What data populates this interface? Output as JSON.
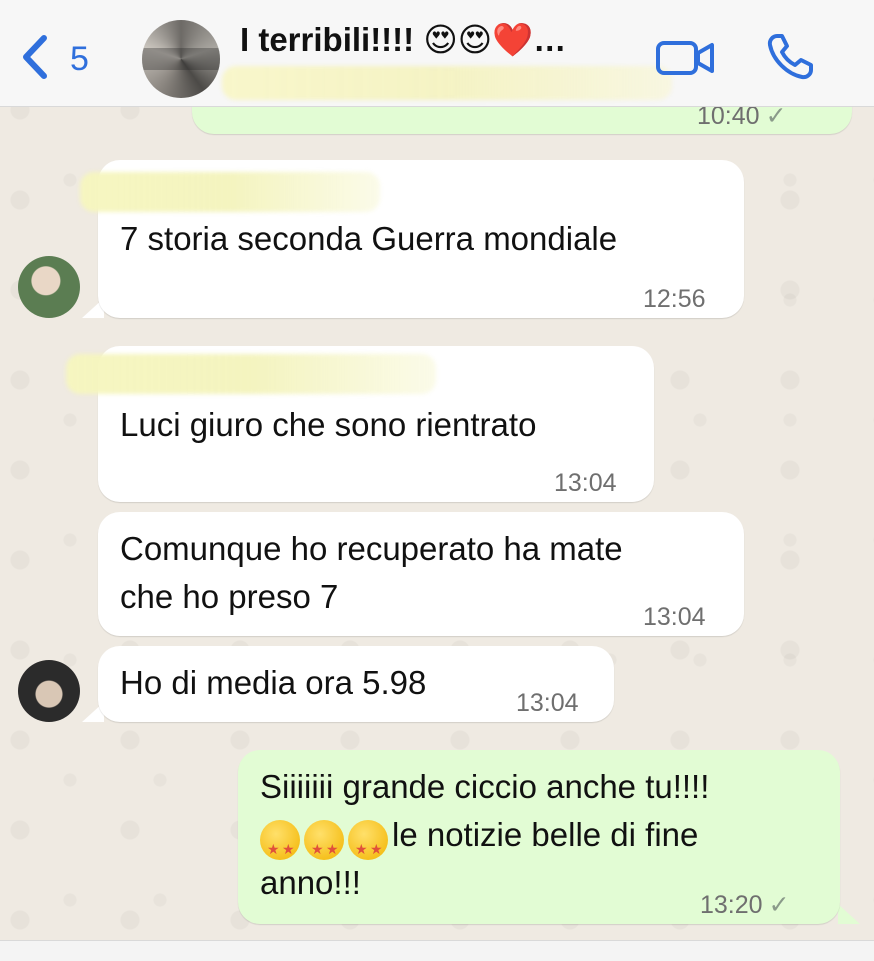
{
  "header": {
    "back_count": "5",
    "title": "I terribili!!!! 😍😍❤️…",
    "icons": [
      "chevron-left-icon",
      "video-call-icon",
      "phone-icon"
    ]
  },
  "messages": [
    {
      "direction": "in",
      "text": "7 storia seconda Guerra mondiale",
      "time": "12:56"
    },
    {
      "direction": "in",
      "text": "Luci giuro che sono rientrato",
      "time": "13:04"
    },
    {
      "direction": "in",
      "lines": [
        "Comunque ho recuperato ha mate",
        "che ho preso 7"
      ],
      "time": "13:04"
    },
    {
      "direction": "in",
      "text": "Ho di media ora 5.98",
      "time": "13:04"
    },
    {
      "direction": "out",
      "lines": [
        "Siiiiiii grande ciccio anche tu!!!!",
        "le notizie belle di fine",
        "anno!!!"
      ],
      "time": "13:20",
      "status": "✓"
    }
  ],
  "partial_top": {
    "time": "10:40",
    "status": "✓"
  },
  "colors": {
    "accent": "#2f6fdc",
    "incoming_bubble": "#ffffff",
    "outgoing_bubble": "#e2fcd4",
    "wallpaper": "#efeae2"
  }
}
